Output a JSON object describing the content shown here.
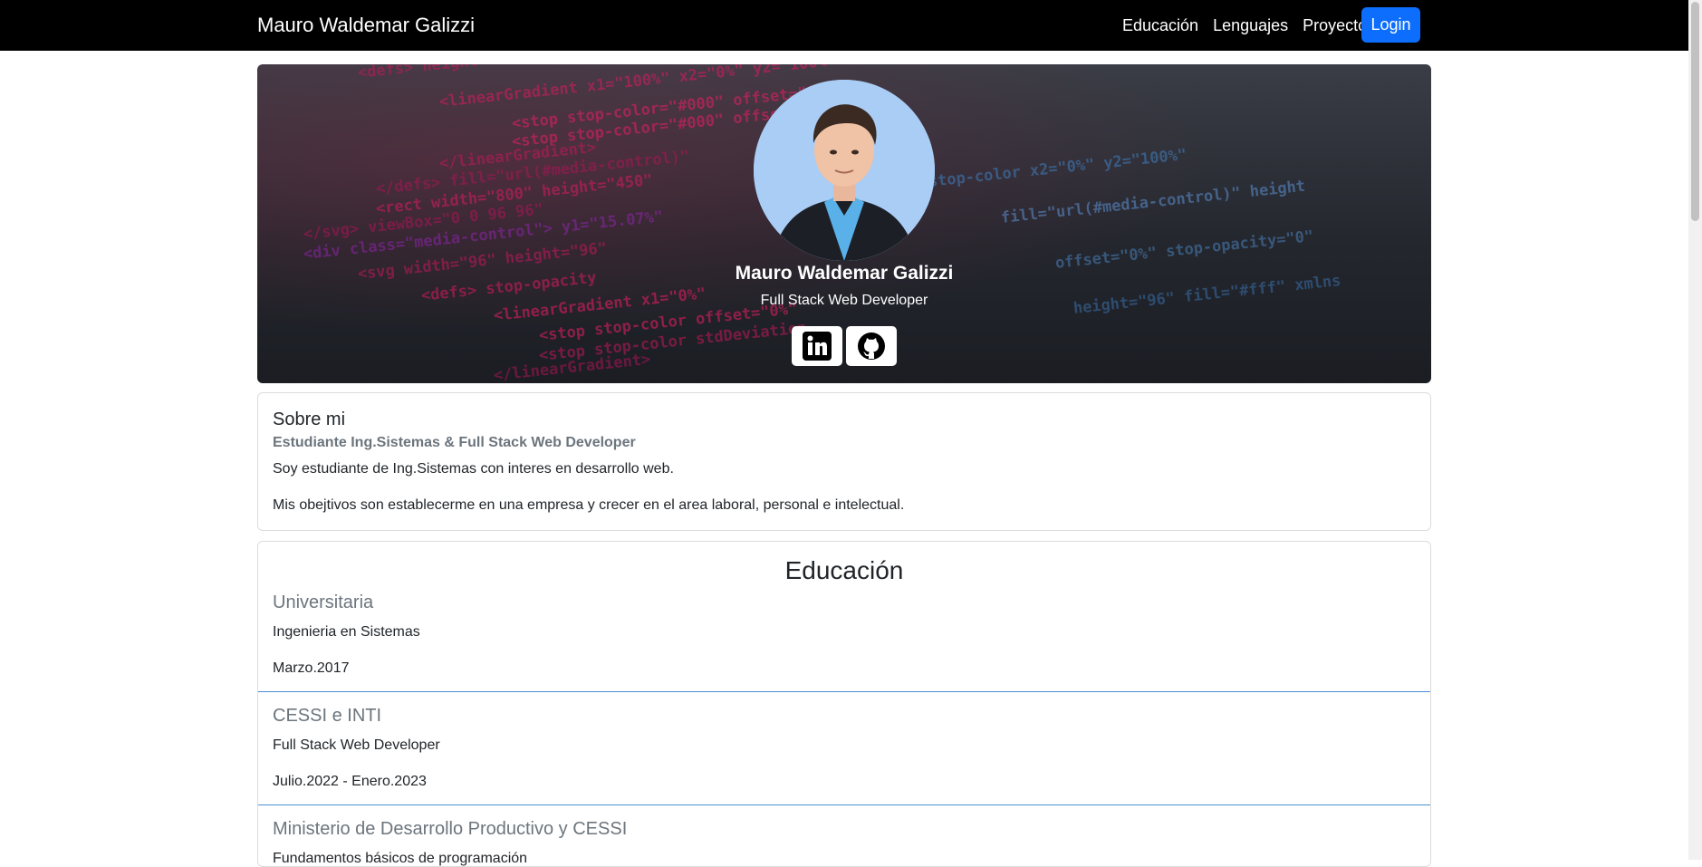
{
  "navbar": {
    "brand": "Mauro Waldemar Galizzi",
    "links": [
      "Educación",
      "Lenguajes",
      "Proyectos"
    ],
    "login_label": "Login"
  },
  "hero": {
    "name": "Mauro Waldemar Galizzi",
    "role": "Full Stack Web Developer",
    "social": [
      "linkedin-icon",
      "github-icon"
    ]
  },
  "about": {
    "title": "Sobre mi",
    "subtitle": "Estudiante Ing.Sistemas & Full Stack Web Developer",
    "text1": "Soy estudiante de Ing.Sistemas con interes en desarrollo web.",
    "text2": "Mis obejtivos son establecerme en una empresa y crecer en el area laboral, personal e intelectual."
  },
  "education": {
    "heading": "Educación",
    "items": [
      {
        "title": "Universitaria",
        "desc": "Ingenieria en Sistemas",
        "period": "Marzo.2017"
      },
      {
        "title": "CESSI e INTI",
        "desc": "Full Stack Web Developer",
        "period": "Julio.2022 - Enero.2023"
      },
      {
        "title": "Ministerio de Desarrollo Productivo y CESSI",
        "desc": "Fundamentos básicos de programación",
        "period": ""
      }
    ]
  },
  "colors": {
    "primary": "#0d6efd",
    "navbar": "#000000",
    "muted": "#6c757d",
    "separator": "#4a8fd6"
  }
}
